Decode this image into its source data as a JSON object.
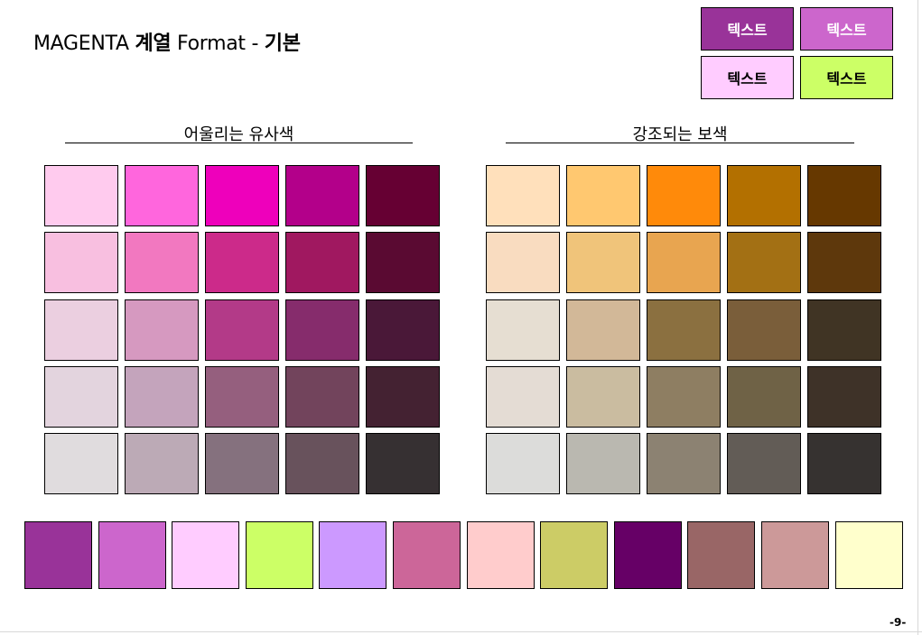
{
  "title": {
    "prefix": "MAGENTA ",
    "bold1": "계열",
    "middle": " Format - ",
    "bold2": "기본"
  },
  "text_buttons": [
    {
      "label": "텍스트",
      "bg": "#993399",
      "fg": "#ffffff"
    },
    {
      "label": "텍스트",
      "bg": "#cc66cc",
      "fg": "#ffffff"
    },
    {
      "label": "텍스트",
      "bg": "#ffccff",
      "fg": "#000000"
    },
    {
      "label": "텍스트",
      "bg": "#ccff66",
      "fg": "#000000"
    }
  ],
  "analogous": {
    "title": "어울리는 유사색",
    "rows": [
      [
        "#ffcbee",
        "#ff66dd",
        "#ee00bb",
        "#b3008a",
        "#660033"
      ],
      [
        "#f8bfe0",
        "#f278c0",
        "#cc2a8a",
        "#a01860",
        "#5a0a32"
      ],
      [
        "#ebcfe0",
        "#d699c0",
        "#b33a88",
        "#862c6c",
        "#4a1838"
      ],
      [
        "#e3d4de",
        "#c4a4bc",
        "#955f7e",
        "#72445c",
        "#442232"
      ],
      [
        "#e0dcde",
        "#bcaab6",
        "#85717e",
        "#68525c",
        "#363032"
      ]
    ]
  },
  "complementary": {
    "title": "강조되는 보색",
    "rows": [
      [
        "#ffe0bb",
        "#ffc870",
        "#ff8a0a",
        "#b37000",
        "#663800"
      ],
      [
        "#f9dcc0",
        "#f0c47a",
        "#e8a550",
        "#a37014",
        "#5e380c"
      ],
      [
        "#e6ded2",
        "#d2b898",
        "#8b7040",
        "#7a5e3a",
        "#403424"
      ],
      [
        "#e4dcd4",
        "#cabca0",
        "#8e7e62",
        "#6f6246",
        "#3e3228"
      ],
      [
        "#dcdcda",
        "#bab8b0",
        "#8c8272",
        "#625c56",
        "#363230"
      ]
    ]
  },
  "bottom_palette": [
    "#993399",
    "#cc66cc",
    "#ffccff",
    "#ccff66",
    "#cc99ff",
    "#cc6699",
    "#ffcccc",
    "#cccc66",
    "#660066",
    "#996666",
    "#cc9999",
    "#ffffcc"
  ],
  "page_number": "-9-"
}
